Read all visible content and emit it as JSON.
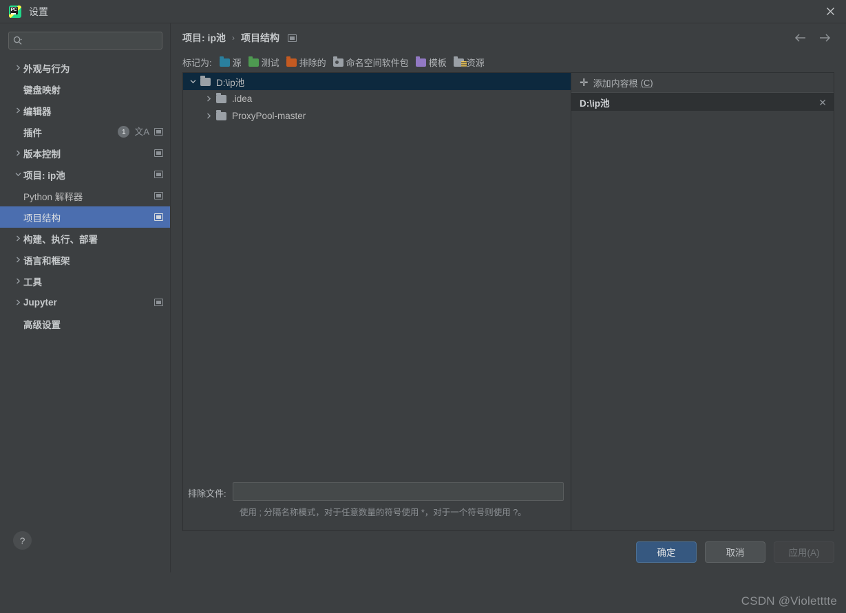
{
  "window": {
    "title": "设置",
    "app_icon": "pycharm-logo",
    "close_label": "✕"
  },
  "sidebar": {
    "search": {
      "value": "",
      "placeholder": "",
      "icon": "search-icon"
    },
    "items": [
      {
        "label": "外观与行为",
        "level": 1,
        "expandable": true,
        "expanded": false,
        "bold": true,
        "selected": false,
        "badge": null,
        "icons": []
      },
      {
        "label": "键盘映射",
        "level": 1,
        "expandable": false,
        "expanded": false,
        "bold": true,
        "selected": false,
        "badge": null,
        "icons": []
      },
      {
        "label": "编辑器",
        "level": 1,
        "expandable": true,
        "expanded": false,
        "bold": true,
        "selected": false,
        "badge": null,
        "icons": []
      },
      {
        "label": "插件",
        "level": 1,
        "expandable": false,
        "expanded": false,
        "bold": true,
        "selected": false,
        "badge": "1",
        "icons": [
          "translate-icon",
          "copy-settings-icon"
        ]
      },
      {
        "label": "版本控制",
        "level": 1,
        "expandable": true,
        "expanded": false,
        "bold": true,
        "selected": false,
        "badge": null,
        "icons": [
          "copy-settings-icon"
        ]
      },
      {
        "label": "项目: ip池",
        "level": 1,
        "expandable": true,
        "expanded": true,
        "bold": true,
        "selected": false,
        "badge": null,
        "icons": [
          "copy-settings-icon"
        ]
      },
      {
        "label": "Python 解释器",
        "level": 2,
        "expandable": false,
        "expanded": false,
        "bold": false,
        "selected": false,
        "badge": null,
        "icons": [
          "copy-settings-icon"
        ]
      },
      {
        "label": "项目结构",
        "level": 2,
        "expandable": false,
        "expanded": false,
        "bold": false,
        "selected": true,
        "badge": null,
        "icons": [
          "copy-settings-icon"
        ]
      },
      {
        "label": "构建、执行、部署",
        "level": 1,
        "expandable": true,
        "expanded": false,
        "bold": true,
        "selected": false,
        "badge": null,
        "icons": []
      },
      {
        "label": "语言和框架",
        "level": 1,
        "expandable": true,
        "expanded": false,
        "bold": true,
        "selected": false,
        "badge": null,
        "icons": []
      },
      {
        "label": "工具",
        "level": 1,
        "expandable": true,
        "expanded": false,
        "bold": true,
        "selected": false,
        "badge": null,
        "icons": []
      },
      {
        "label": "Jupyter",
        "level": 1,
        "expandable": true,
        "expanded": false,
        "bold": true,
        "selected": false,
        "badge": null,
        "icons": [
          "copy-settings-icon"
        ]
      },
      {
        "label": "高级设置",
        "level": 1,
        "expandable": false,
        "expanded": false,
        "bold": true,
        "selected": false,
        "badge": null,
        "icons": []
      }
    ],
    "help_button": "?"
  },
  "content": {
    "breadcrumb": {
      "items": [
        "项目: ip池",
        "项目结构"
      ],
      "separator": "›",
      "trailing_icon": "copy-settings-icon"
    },
    "nav": {
      "back_icon": "arrow-left-icon",
      "forward_icon": "arrow-right-icon"
    },
    "mark_as": {
      "label": "标记为:",
      "chips": [
        {
          "label": "源",
          "color": "#2a7f9e",
          "icon": "folder-icon"
        },
        {
          "label": "测试",
          "color": "#4e9a51",
          "icon": "folder-icon"
        },
        {
          "label": "排除的",
          "color": "#c45a21",
          "icon": "folder-icon"
        },
        {
          "label": "命名空间软件包",
          "color": "#9aa0a6",
          "icon": "folder-namespace-icon"
        },
        {
          "label": "模板",
          "color": "#9279c4",
          "icon": "folder-icon"
        },
        {
          "label": "资源",
          "color": "#9aa0a6",
          "icon": "folder-resource-icon"
        }
      ]
    },
    "tree": {
      "rows": [
        {
          "label": "D:\\ip池",
          "depth": 0,
          "expanded": true,
          "has_children": true,
          "selected": true
        },
        {
          "label": ".idea",
          "depth": 1,
          "expanded": false,
          "has_children": true,
          "selected": false
        },
        {
          "label": "ProxyPool-master",
          "depth": 1,
          "expanded": false,
          "has_children": true,
          "selected": false
        }
      ]
    },
    "excluded_files": {
      "label": "排除文件:",
      "value": "",
      "placeholder": "",
      "hint": "使用 ; 分隔名称模式，对于任意数量的符号使用 *，对于一个符号则使用 ?。"
    },
    "content_roots": {
      "add_label": "添加内容根",
      "add_accel": "(C)",
      "add_icon": "plus-icon",
      "items": [
        {
          "path": "D:\\ip池",
          "remove_icon": "close-icon"
        }
      ]
    }
  },
  "footer": {
    "ok_label": "确定",
    "cancel_label": "取消",
    "apply_label": "应用(A)",
    "apply_disabled": true
  },
  "watermark": "CSDN @Violetttte",
  "colors": {
    "window_bg": "#3c3f41",
    "panel_border": "#2e3032",
    "selection_blue": "#4b6eaf",
    "tree_selection": "#0d293e",
    "button_default": "#365880",
    "text": "#bbbbbb"
  }
}
